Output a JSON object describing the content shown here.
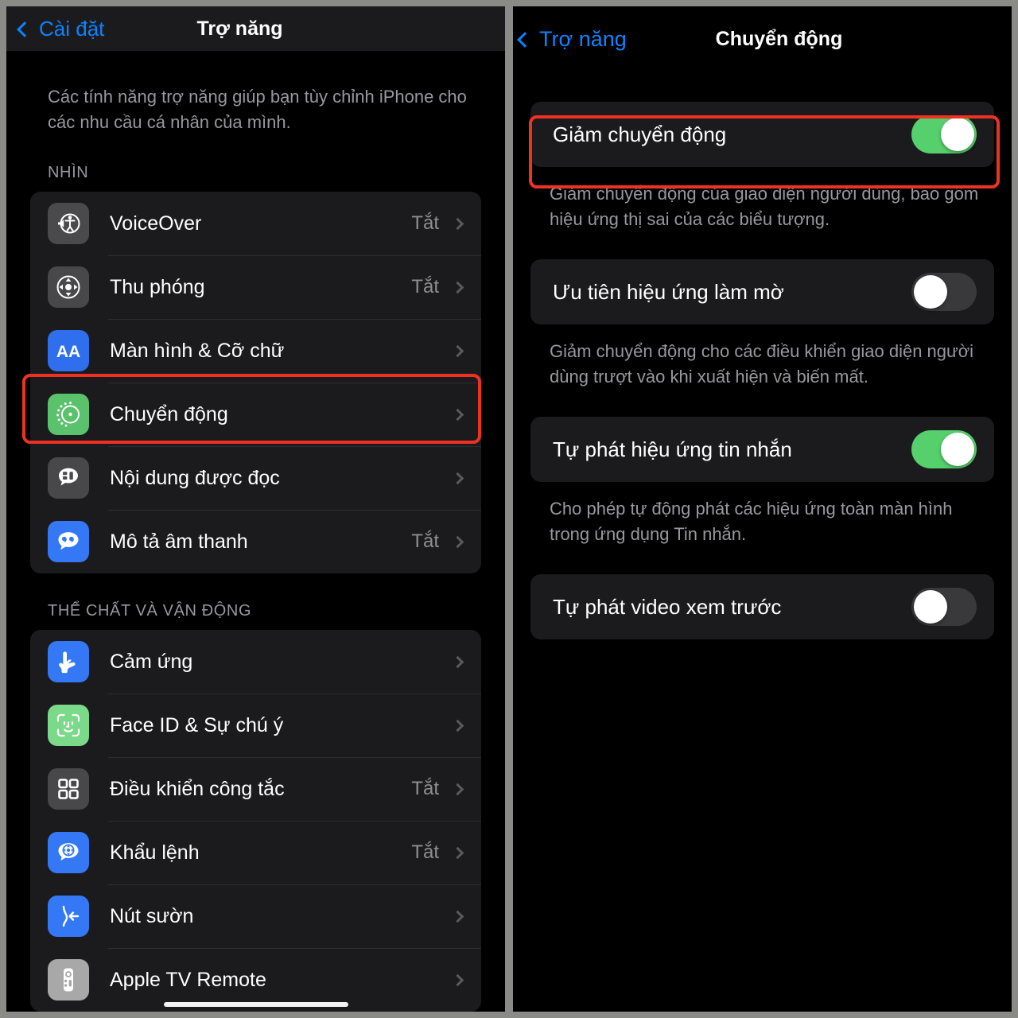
{
  "theme": {
    "accent_blue": "#0a84ff",
    "highlight_red": "#ef3124",
    "toggle_on_green": "#56cf6d",
    "toggle_off_grey": "#39393c",
    "card_bg": "#1b1b1d",
    "screen_bg": "#000000",
    "secondary_text": "#98989d"
  },
  "left_screen": {
    "navbar": {
      "back_label": "Cài đặt",
      "title": "Trợ năng",
      "back_icon": "chevron-left-icon"
    },
    "intro_text": "Các tính năng trợ năng giúp bạn tùy chỉnh iPhone cho các nhu cầu cá nhân của mình.",
    "sections": [
      {
        "header": "NHÌN",
        "items": [
          {
            "label": "VoiceOver",
            "value": "Tắt",
            "icon": "voiceover-icon",
            "icon_class": "ic-grey",
            "highlighted": false
          },
          {
            "label": "Thu phóng",
            "value": "Tắt",
            "icon": "zoom-icon",
            "icon_class": "ic-grey2",
            "highlighted": false
          },
          {
            "label": "Màn hình & Cỡ chữ",
            "value": "",
            "icon": "display-text-icon",
            "icon_class": "ic-blue",
            "highlighted": false
          },
          {
            "label": "Chuyển động",
            "value": "",
            "icon": "motion-icon",
            "icon_class": "ic-green",
            "highlighted": true
          },
          {
            "label": "Nội dung được đọc",
            "value": "",
            "icon": "spoken-content-icon",
            "icon_class": "ic-grey2",
            "highlighted": false
          },
          {
            "label": "Mô tả âm thanh",
            "value": "Tắt",
            "icon": "audio-desc-icon",
            "icon_class": "ic-blue2",
            "highlighted": false
          }
        ]
      },
      {
        "header": "THỂ CHẤT VÀ VẬN ĐỘNG",
        "items": [
          {
            "label": "Cảm ứng",
            "value": "",
            "icon": "touch-icon",
            "icon_class": "ic-blue2",
            "highlighted": false
          },
          {
            "label": "Face ID & Sự chú ý",
            "value": "",
            "icon": "face-id-icon",
            "icon_class": "ic-green2",
            "highlighted": false
          },
          {
            "label": "Điều khiển công tắc",
            "value": "Tắt",
            "icon": "switch-control-icon",
            "icon_class": "ic-grey2",
            "highlighted": false
          },
          {
            "label": "Khẩu lệnh",
            "value": "Tắt",
            "icon": "voice-control-icon",
            "icon_class": "ic-blue2",
            "highlighted": false
          },
          {
            "label": "Nút sườn",
            "value": "",
            "icon": "side-button-icon",
            "icon_class": "ic-blue2",
            "highlighted": false
          },
          {
            "label": "Apple TV Remote",
            "value": "",
            "icon": "apple-tv-remote-icon",
            "icon_class": "ic-silver",
            "highlighted": false
          }
        ]
      }
    ]
  },
  "right_screen": {
    "navbar": {
      "back_label": "Trợ năng",
      "title": "Chuyển động",
      "back_icon": "chevron-left-icon"
    },
    "settings": [
      {
        "label": "Giảm chuyển động",
        "state": "on",
        "state_label": "Bật",
        "footnote": "Giảm chuyển động của giao diện người dùng, bao gồm hiệu ứng thị sai của các biểu tượng.",
        "highlighted": true
      },
      {
        "label": "Ưu tiên hiệu ứng làm mờ",
        "state": "off",
        "state_label": "Tắt",
        "footnote": "Giảm chuyển động cho các điều khiển giao diện người dùng trượt vào khi xuất hiện và biến mất.",
        "highlighted": false
      },
      {
        "label": "Tự phát hiệu ứng tin nhắn",
        "state": "on",
        "state_label": "Bật",
        "footnote": "Cho phép tự động phát các hiệu ứng toàn màn hình trong ứng dụng Tin nhắn.",
        "highlighted": false
      },
      {
        "label": "Tự phát video xem trước",
        "state": "off",
        "state_label": "Tắt",
        "footnote": "",
        "highlighted": false
      }
    ]
  }
}
